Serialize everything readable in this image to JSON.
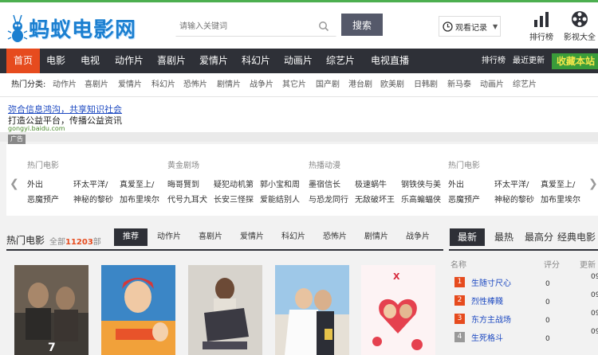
{
  "header": {
    "logo_text": "蚂蚁电影网",
    "search_placeholder": "请输入关键词",
    "search_button": "搜索",
    "history_label": "观看记录",
    "ranking_label": "排行榜",
    "all_movies_label": "影视大全"
  },
  "nav": {
    "items": [
      "首页",
      "电影",
      "电视",
      "动作片",
      "喜剧片",
      "爱情片",
      "科幻片",
      "动画片",
      "综艺片",
      "电视直播"
    ],
    "right": [
      "排行榜",
      "最近更新"
    ],
    "collect": "收藏本站"
  },
  "categories": {
    "label": "热门分类:",
    "items": [
      "动作片",
      "喜剧片",
      "爱情片",
      "科幻片",
      "恐怖片",
      "剧情片",
      "战争片",
      "其它片",
      "国产剧",
      "港台剧",
      "欧美剧",
      "日韩剧",
      "新马泰",
      "动画片",
      "综艺片"
    ]
  },
  "ad": {
    "link": "弥合信息鸿沟，共享知识社会",
    "desc": "打造公益平台，传播公益资讯",
    "url": "gongyi.baidu.com",
    "tag": "广告"
  },
  "cards": [
    {
      "title": "热门电影",
      "items": [
        "外出",
        "环太平洋/",
        "真爱至上/",
        "恶魔预产",
        "神秘的黎砂",
        "加布里埃尔"
      ]
    },
    {
      "title": "黄金剧场",
      "items": [
        "晦哥賢到",
        "疑犯动机第",
        "郭小宝和周",
        "代号九耳犬",
        "长安三怪探",
        "爱能结别人"
      ]
    },
    {
      "title": "热播动漫",
      "items": [
        "墨宿信长",
        "极速蜗牛",
        "钢铁侠与美",
        "与恐龙同行",
        "无敌破坏王",
        "乐高蝙蝠侠"
      ]
    },
    {
      "title": "热门电影",
      "items": [
        "外出",
        "环太平洋/",
        "真爱至上/",
        "恶魔预产",
        "神秘的黎砂",
        "加布里埃尔"
      ]
    }
  ],
  "hot": {
    "title": "热门电影",
    "count_prefix": "全部",
    "count_value": "11203",
    "count_suffix": "部",
    "tabs": [
      "推荐",
      "动作片",
      "喜剧片",
      "爱情片",
      "科幻片",
      "恐怖片",
      "剧情片",
      "战争片"
    ]
  },
  "ranking": {
    "tabs": [
      "最新",
      "最热",
      "最高分",
      "经典电影"
    ],
    "col_name": "名称",
    "col_score": "评分",
    "col_update": "更新",
    "rows": [
      {
        "num": "1",
        "name": "生随寸尺心",
        "score": "0",
        "update": "09"
      },
      {
        "num": "2",
        "name": "烈性棒賤",
        "score": "0",
        "update": "09"
      },
      {
        "num": "3",
        "name": "东方主战场",
        "score": "0",
        "update": "09"
      },
      {
        "num": "4",
        "name": "生死格斗",
        "score": "0",
        "update": "09"
      }
    ]
  },
  "colors": {
    "accent": "#e64b1e",
    "nav": "#2e3037",
    "link": "#1a47c0"
  }
}
